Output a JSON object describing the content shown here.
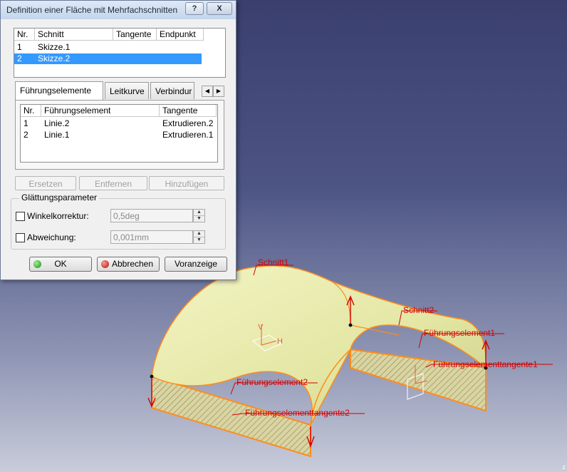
{
  "dialog": {
    "title": "Definition einer Fläche mit Mehrfachschnitten",
    "help_label": "?",
    "close_label": "X",
    "sections": {
      "headers": [
        "Nr.",
        "Schnitt",
        "Tangente",
        "Endpunkt"
      ],
      "rows": [
        {
          "nr": "1",
          "schnitt": "Skizze.1",
          "selected": false
        },
        {
          "nr": "2",
          "schnitt": "Skizze.2",
          "selected": true
        }
      ]
    },
    "tabs": [
      {
        "label": "Führungselemente",
        "active": true
      },
      {
        "label": "Leitkurve",
        "active": false
      },
      {
        "label": "Verbindur",
        "active": false
      }
    ],
    "guides": {
      "headers": [
        "Nr.",
        "Führungselement",
        "Tangente"
      ],
      "rows": [
        {
          "nr": "1",
          "element": "Linie.2",
          "tangente": "Extrudieren.2"
        },
        {
          "nr": "2",
          "element": "Linie.1",
          "tangente": "Extrudieren.1"
        }
      ]
    },
    "actions": {
      "replace": "Ersetzen",
      "remove": "Entfernen",
      "add": "Hinzufügen"
    },
    "smoothing": {
      "title": "Glättungsparameter",
      "angle_label": "Winkelkorrektur:",
      "angle_value": "0,5deg",
      "deviation_label": "Abweichung:",
      "deviation_value": "0,001mm"
    },
    "buttons": {
      "ok": "OK",
      "cancel": "Abbrechen",
      "preview": "Voranzeige"
    }
  },
  "viewport": {
    "labels": {
      "schnitt1": "Schnitt1",
      "schnitt2": "Schnitt2",
      "fuehrung1": "Führungselement1",
      "fuehrung2": "Führungselement2",
      "tangente1": "Führungselementtangente1",
      "tangente2": "Führungselementtangente2",
      "axis_v": "V",
      "axis_h": "H",
      "corner": "z"
    }
  },
  "colors": {
    "surface": "#eef0b0",
    "edge": "#ff8c1a",
    "label": "#d40000",
    "selection": "#3399ff"
  }
}
